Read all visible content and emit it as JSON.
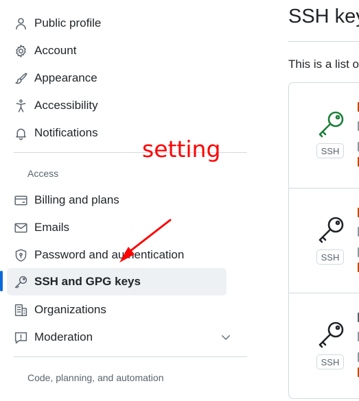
{
  "sidebar": {
    "items_top": [
      {
        "label": "Public profile",
        "icon": "person-icon"
      },
      {
        "label": "Account",
        "icon": "gear-icon"
      },
      {
        "label": "Appearance",
        "icon": "paintbrush-icon"
      },
      {
        "label": "Accessibility",
        "icon": "accessibility-icon"
      },
      {
        "label": "Notifications",
        "icon": "bell-icon"
      }
    ],
    "access_heading": "Access",
    "items_access": [
      {
        "label": "Billing and plans",
        "icon": "credit-card-icon"
      },
      {
        "label": "Emails",
        "icon": "mail-icon"
      },
      {
        "label": "Password and authentication",
        "icon": "shield-lock-icon"
      },
      {
        "label": "SSH and GPG keys",
        "icon": "key-icon",
        "selected": true
      },
      {
        "label": "Organizations",
        "icon": "organization-icon"
      },
      {
        "label": "Moderation",
        "icon": "report-icon"
      }
    ],
    "code_heading": "Code, planning, and automation"
  },
  "annotation": {
    "text": "setting",
    "color": "#ff0000"
  },
  "main": {
    "title": "SSH key",
    "description": "This is a list o",
    "keys": [
      {
        "badge": "SSH",
        "icon": "key-icon",
        "icon_color": "#1a7f37"
      },
      {
        "badge": "SSH",
        "icon": "key-icon",
        "icon_color": "#1f2328"
      },
      {
        "badge": "SSH",
        "icon": "key-icon",
        "icon_color": "#1f2328"
      }
    ]
  },
  "colors": {
    "accent": "#0969da",
    "key_active": "#1a7f37",
    "warning_fragment": "#bc4c00"
  }
}
